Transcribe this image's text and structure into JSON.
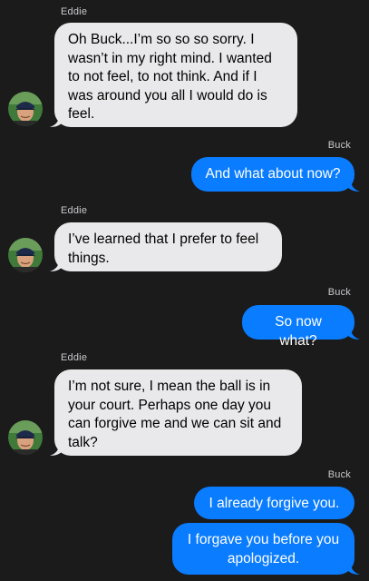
{
  "colors": {
    "background": "#1b1b1b",
    "incoming_bubble": "#e9e9eb",
    "outgoing_bubble": "#0a7cff",
    "sender_label": "#c9c9cd"
  },
  "messages": [
    {
      "sender": "Eddie",
      "direction": "incoming",
      "text": "Oh Buck...I’m so so so sorry. I wasn’t in my right mind. I wanted to not feel, to not think. And if I was around you all I would do is feel."
    },
    {
      "sender": "Buck",
      "direction": "outgoing",
      "text": "And what about now?"
    },
    {
      "sender": "Eddie",
      "direction": "incoming",
      "text": "I’ve learned that I prefer to feel things."
    },
    {
      "sender": "Buck",
      "direction": "outgoing",
      "text": "So now what?"
    },
    {
      "sender": "Eddie",
      "direction": "incoming",
      "text": "I’m not sure, I mean the ball is in your court. Perhaps one day you can forgive me and we can sit and talk?"
    },
    {
      "sender": "Buck",
      "direction": "outgoing",
      "text": "I already forgive you."
    },
    {
      "sender": "Buck",
      "direction": "outgoing",
      "text": "I forgave you before you apologized."
    }
  ],
  "avatar": {
    "icon": "contact-avatar-icon"
  }
}
